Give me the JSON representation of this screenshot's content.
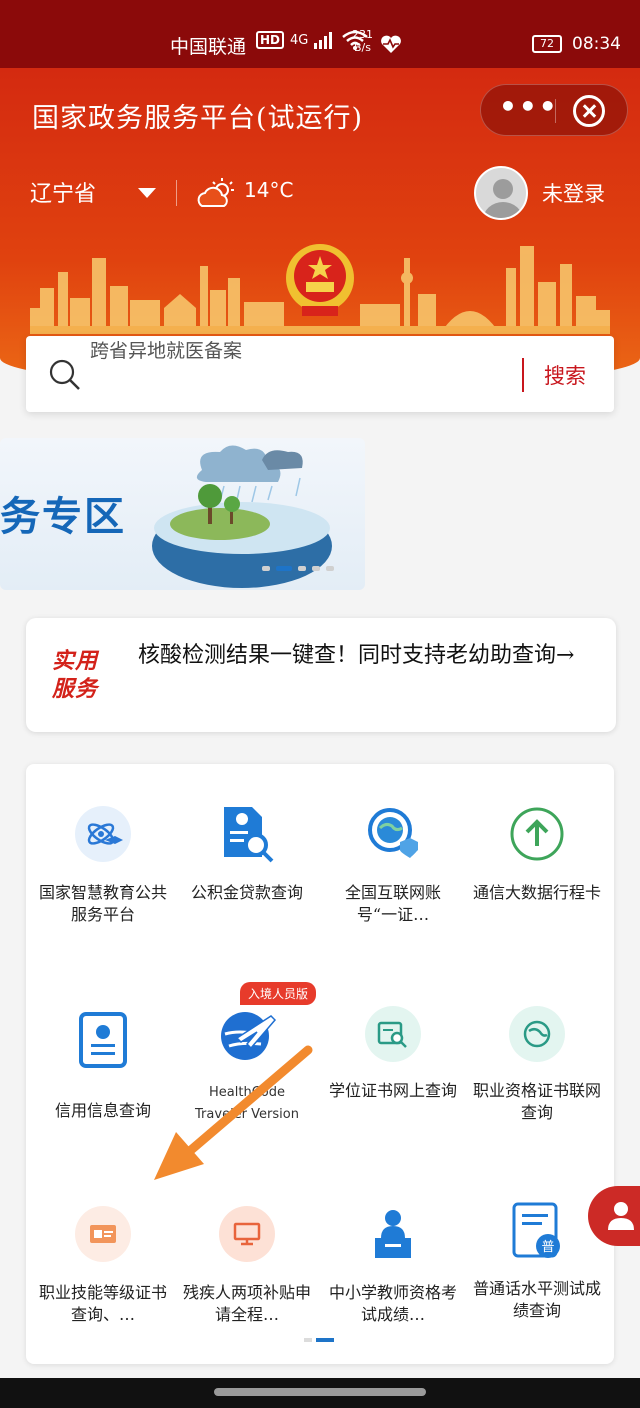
{
  "status_bar": {
    "carrier": "中国联通",
    "hd": "HD",
    "network": "4G",
    "speed_value": "231",
    "speed_unit": "B/s",
    "battery": "72",
    "time": "08:34"
  },
  "header": {
    "title": "国家政务服务平台(试运行)",
    "more_label": "•••",
    "region": "辽宁省",
    "temperature": "14°C",
    "login_label": "未登录"
  },
  "search": {
    "placeholder": "跨省异地就医备案",
    "button": "搜索"
  },
  "banner": {
    "title": "务专区",
    "slide_count": 5,
    "active_slide": 1
  },
  "notice": {
    "tag_line1": "实用",
    "tag_line2": "服务",
    "text": "核酸检测结果一键查！同时支持老幼助查询→"
  },
  "services": {
    "badge": "入境人员版",
    "items": [
      {
        "label": "国家智慧教育公共服务平台",
        "icon": "atom-graduation-icon"
      },
      {
        "label": "公积金贷款查询",
        "icon": "document-search-icon"
      },
      {
        "label": "全国互联网账号“一证…",
        "icon": "globe-shield-icon"
      },
      {
        "label": "通信大数据行程卡",
        "icon": "arrow-up-circle-icon"
      },
      {
        "label": "信用信息查询",
        "icon": "id-card-icon"
      },
      {
        "label": "HealthCode Traveler Version",
        "icon": "airplane-globe-icon"
      },
      {
        "label": "学位证书网上查询",
        "icon": "certificate-search-icon"
      },
      {
        "label": "职业资格证书联网查询",
        "icon": "network-globe-icon"
      },
      {
        "label": "职业技能等级证书查询、…",
        "icon": "skill-certificate-icon"
      },
      {
        "label": "残疾人两项补贴申请全程…",
        "icon": "monitor-icon"
      },
      {
        "label": "中小学教师资格考试成绩…",
        "icon": "teacher-podium-icon"
      },
      {
        "label": "普通话水平测试成绩查询",
        "icon": "mandarin-test-icon"
      }
    ],
    "page_count": 2,
    "active_page": 2
  },
  "colors": {
    "brand_red": "#d42a10",
    "accent_blue": "#1e74c8",
    "arrow_orange": "#f28a2e"
  }
}
